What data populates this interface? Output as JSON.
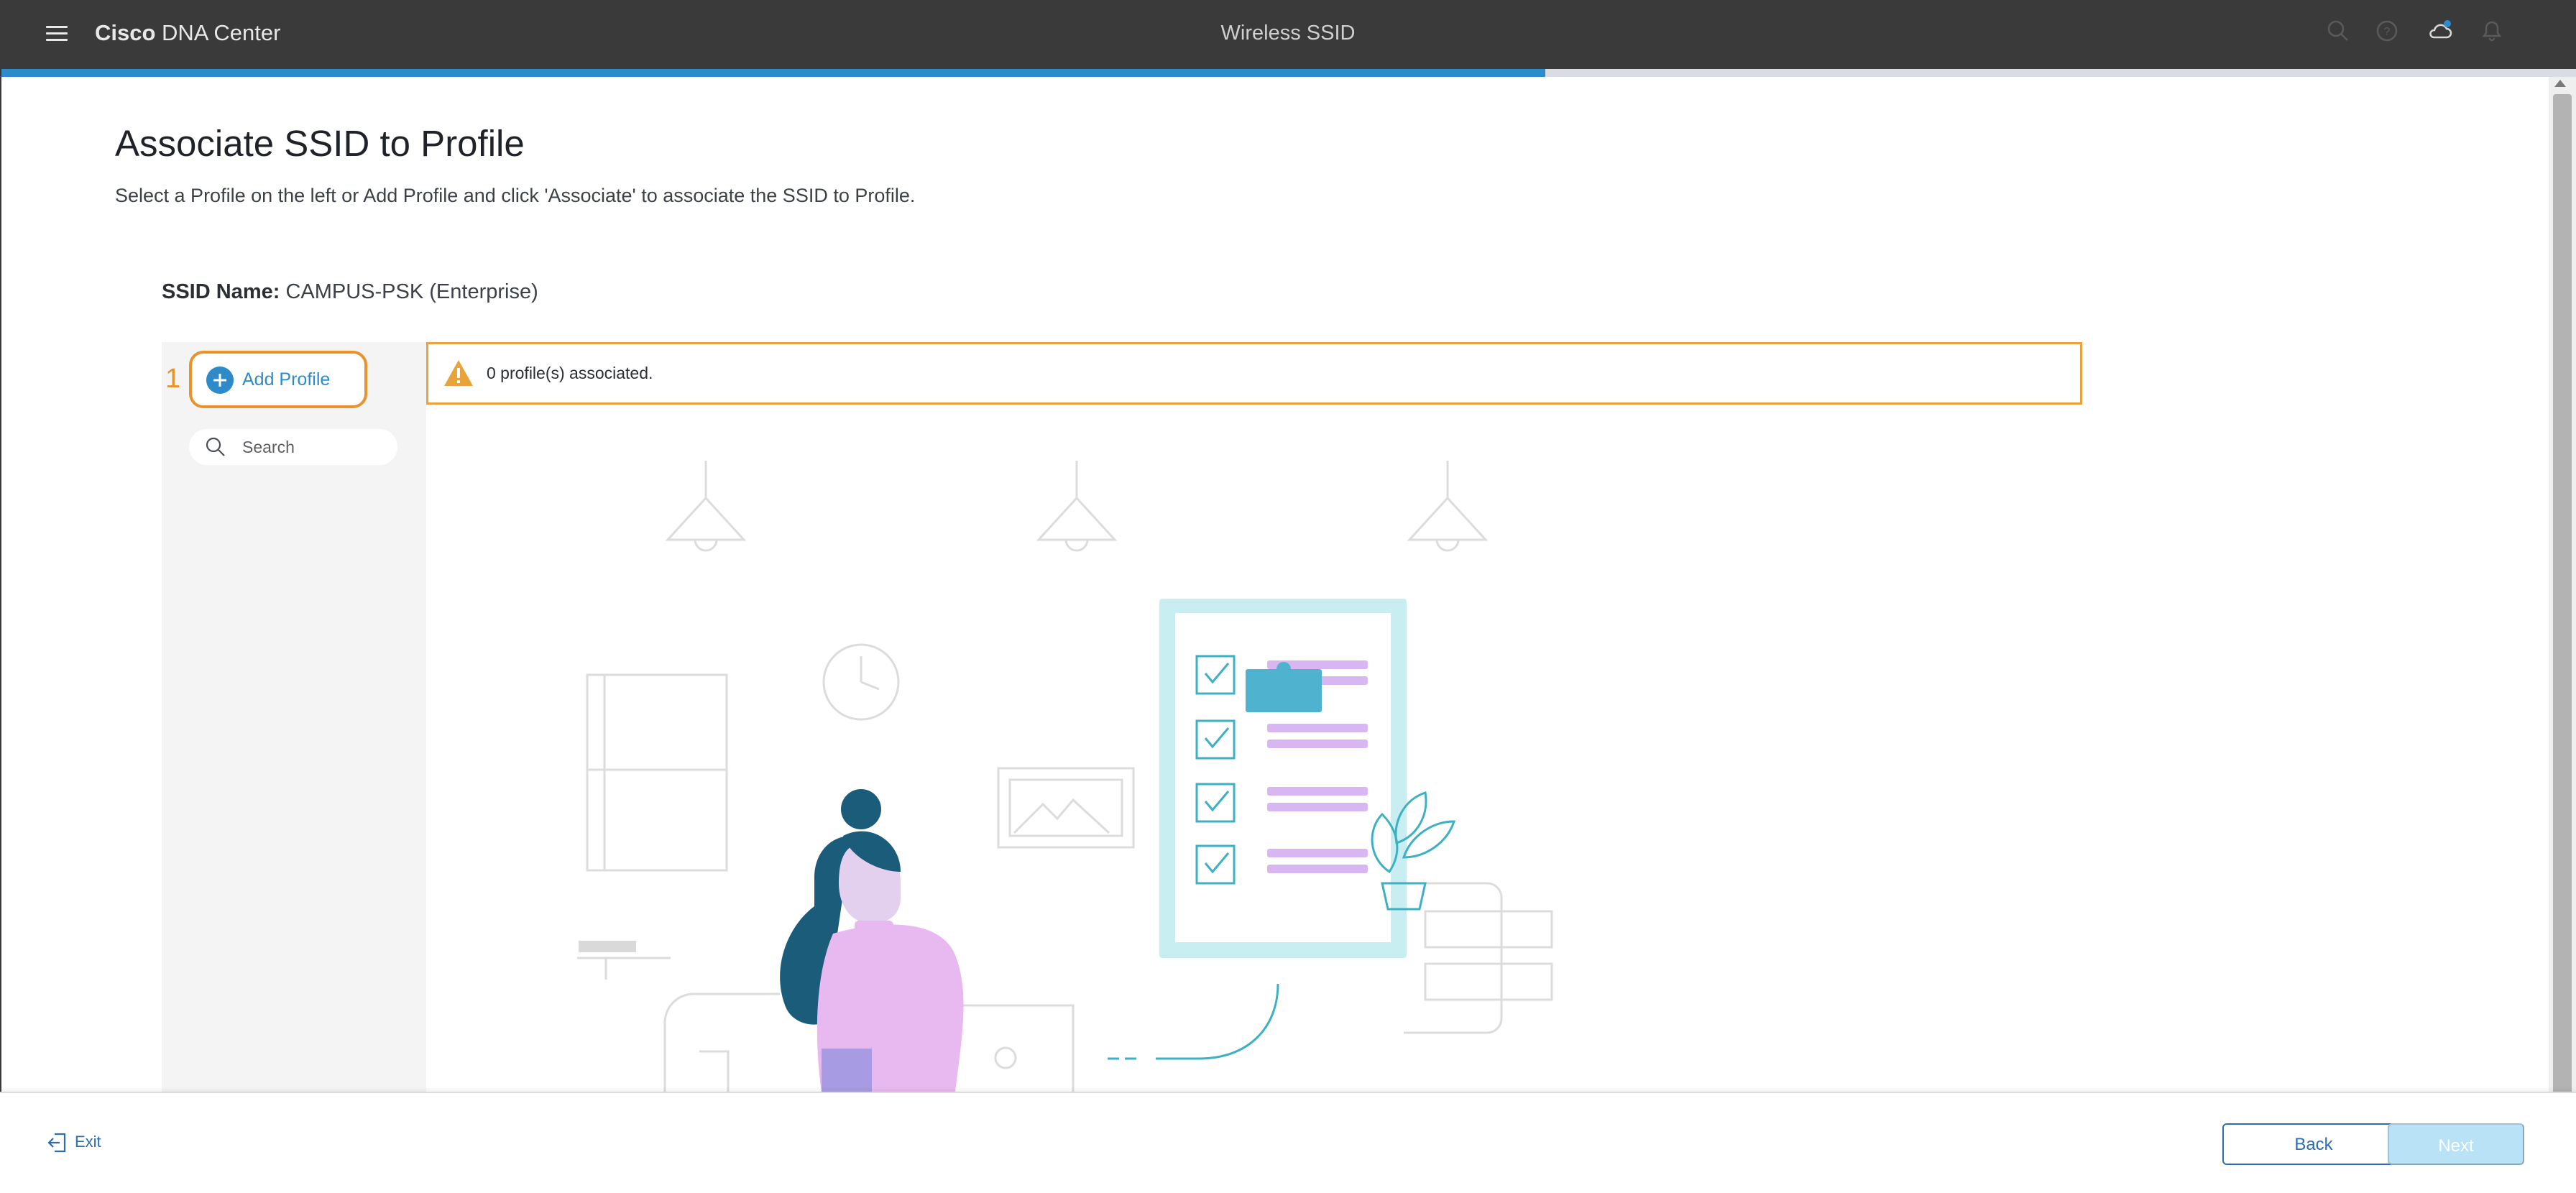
{
  "header": {
    "brand_bold": "Cisco",
    "brand_rest": " DNA Center",
    "title": "Wireless SSID",
    "icons": [
      "search-icon",
      "help-icon",
      "cloud-notification-icon",
      "bell-icon"
    ],
    "progress_fraction": 0.6
  },
  "main": {
    "title": "Associate SSID to Profile",
    "description": "Select a Profile on the left or Add Profile and click 'Associate' to associate the SSID to Profile.",
    "ssid_label": "SSID Name:",
    "ssid_value": " CAMPUS-PSK (Enterprise)"
  },
  "left_panel": {
    "step_number": "1",
    "add_profile_label": "Add Profile",
    "search_placeholder": "Search"
  },
  "alert": {
    "icon": "warning-icon",
    "text": "0 profile(s) associated."
  },
  "footer": {
    "exit_label": "Exit",
    "back_label": "Back",
    "next_label": "Next"
  },
  "colors": {
    "accent": "#2e8bc9",
    "highlight": "#e8932b",
    "header_bg": "#3a3a3a",
    "next_disabled": "#b9e2f6"
  }
}
